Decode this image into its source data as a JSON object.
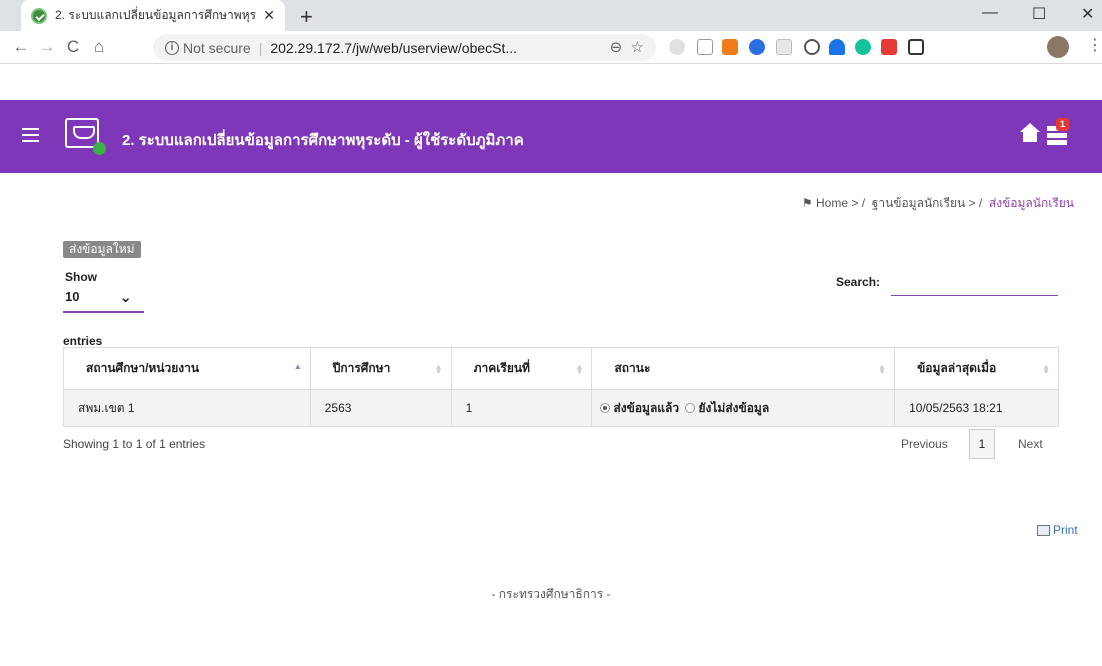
{
  "browser": {
    "tab_title": "2. ระบบแลกเปลี่ยนข้อมูลการศึกษาพหุร",
    "tab_close": "✕",
    "new_tab": "+",
    "url_security": "Not secure",
    "url": "202.29.172.7/jw/web/userview/obecSt...",
    "window_controls": [
      "—",
      "☐",
      "✕"
    ]
  },
  "app": {
    "title": "2. ระบบแลกเปลี่ยนข้อมูลการศึกษาพหุระดับ - ผู้ใช้ระดับภูมิภาค",
    "notification_count": "1",
    "accent_color": "#7e37b8"
  },
  "breadcrumb": {
    "home": "Home",
    "level1": "ฐานข้อมูลนักเรียน",
    "current": "ส่งข้อมูลนักเรียน",
    "sep": " / "
  },
  "controls": {
    "new_button": "ส่งข้อมูลใหม่",
    "show_label": "Show",
    "show_value": "10",
    "search_label": "Search:",
    "search_value": "",
    "entries_label": "entries"
  },
  "table": {
    "headers": [
      "สถานศึกษา/หน่วยงาน",
      "ปีการศึกษา",
      "ภาคเรียนที่",
      "สถานะ",
      "ข้อมูลล่าสุดเมื่อ"
    ],
    "rows": [
      {
        "unit": "สพม.เขต 1",
        "year": "2563",
        "term": "1",
        "status_sent": "ส่งข้อมูลแล้ว",
        "status_not_sent": "ยังไม่ส่งข้อมูล",
        "updated": "10/05/2563 18:21"
      }
    ]
  },
  "pagination": {
    "info": "Showing 1 to 1 of 1 entries",
    "previous": "Previous",
    "current_page": "1",
    "next": "Next"
  },
  "print_label": "Print",
  "footer": "- กระทรวงศึกษาธิการ -"
}
